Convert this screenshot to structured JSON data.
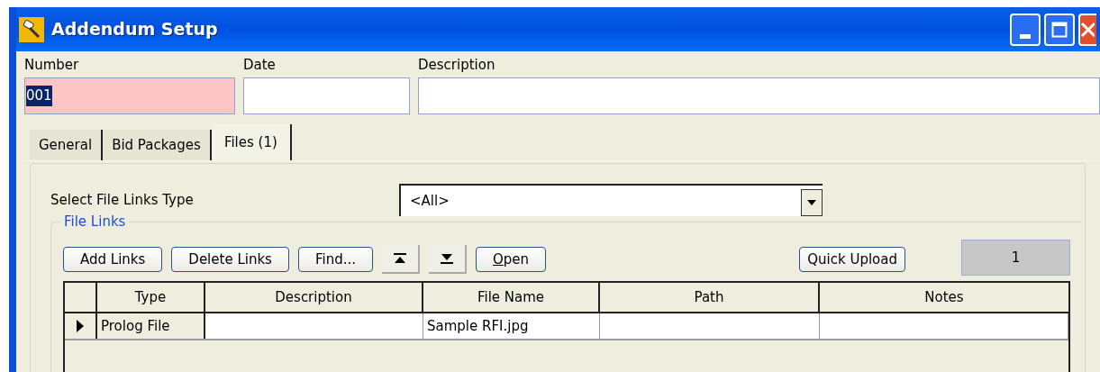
{
  "window": {
    "title": "Addendum Setup"
  },
  "header_fields": [
    {
      "label": "Number",
      "value": "001",
      "required": true,
      "selected_text": true
    },
    {
      "label": "Date",
      "required": false
    },
    {
      "label": "Description",
      "required": false
    }
  ],
  "tabs": [
    {
      "label": "General",
      "selected": false
    },
    {
      "label": "Bid Packages",
      "selected": false
    },
    {
      "label": "Files (1)",
      "selected": true
    }
  ],
  "file_links_type": {
    "label": "Select File Links Type",
    "value": "<All>"
  },
  "file_links": {
    "title": "File Links",
    "toolbar": [
      {
        "kind": "text",
        "label": "Add Links"
      },
      {
        "kind": "text",
        "label": "Delete Links"
      },
      {
        "kind": "text",
        "label": "Find..."
      },
      {
        "kind": "up"
      },
      {
        "kind": "down"
      },
      {
        "kind": "text",
        "label": "Open",
        "mnemonic": true
      }
    ],
    "quick_upload": "Quick Upload",
    "count": "1",
    "table": {
      "columns": [
        "Type",
        "Description",
        "File Name",
        "Path",
        "Notes"
      ],
      "rows": [
        {
          "selected": true,
          "cells": [
            "Prolog File",
            "",
            "Sample RFI.jpg",
            "",
            ""
          ]
        }
      ]
    }
  }
}
